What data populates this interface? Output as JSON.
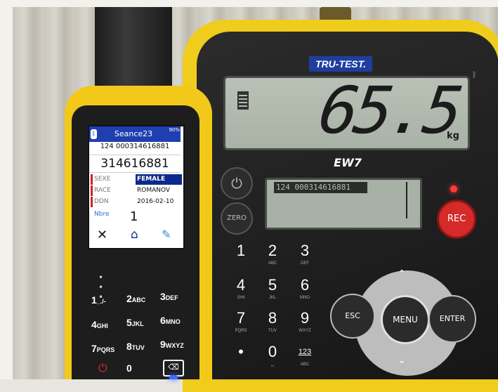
{
  "scale_indicator": {
    "brand": "TRU-TEST.",
    "model": "EW7",
    "weight_value": "65.5",
    "weight_unit": "kg",
    "secondary_display": "124 000314616881",
    "buttons": {
      "power": "⏻",
      "zero": "ZERO",
      "rec": "REC",
      "esc": "ESC",
      "menu": "MENU",
      "enter": "ENTER",
      "up": "⌃",
      "down": "⌄"
    },
    "keypad": [
      {
        "digit": "1",
        "letters": ""
      },
      {
        "digit": "2",
        "letters": "ABC"
      },
      {
        "digit": "3",
        "letters": "DEF"
      },
      {
        "digit": "4",
        "letters": "GHI"
      },
      {
        "digit": "5",
        "letters": "JKL"
      },
      {
        "digit": "6",
        "letters": "MNO"
      },
      {
        "digit": "7",
        "letters": "PQRS"
      },
      {
        "digit": "8",
        "letters": "TUV"
      },
      {
        "digit": "9",
        "letters": "WXYZ"
      },
      {
        "digit": "•",
        "letters": ""
      },
      {
        "digit": "0",
        "letters": "␣"
      },
      {
        "digit": "123",
        "letters": "ABC"
      }
    ]
  },
  "reader": {
    "screen": {
      "session": "Seance23",
      "battery": "90%",
      "eid": "124 000314616881",
      "tag": "314616881",
      "fields": [
        {
          "label": "SEXE",
          "value": "FEMALE"
        },
        {
          "label": "RACE",
          "value": "ROMANOV"
        },
        {
          "label": "DDN",
          "value": "2016-02-10"
        }
      ],
      "count_label": "Nbre",
      "count_value": "1",
      "icons": {
        "close": "✕",
        "home": "⌂",
        "edit": "✎",
        "bluetooth": "ᛒ"
      }
    },
    "keys": [
      {
        "digit": "1",
        "letters": "_./-"
      },
      {
        "digit": "2",
        "letters": "ABC"
      },
      {
        "digit": "3",
        "letters": "DEF"
      },
      {
        "digit": "4",
        "letters": "GHI"
      },
      {
        "digit": "5",
        "letters": "JKL"
      },
      {
        "digit": "6",
        "letters": "MNO"
      },
      {
        "digit": "7",
        "letters": "PQRS"
      },
      {
        "digit": "8",
        "letters": "TUV"
      },
      {
        "digit": "9",
        "letters": "WXYZ"
      },
      {
        "digit": "0",
        "letters": ""
      }
    ],
    "dots": "• • •",
    "power_glyph": "⏻",
    "backspace_glyph": "⌫"
  },
  "colors": {
    "device_yellow": "#f0cc1c",
    "rec_red": "#d42a2a",
    "brand_blue": "#1f3ea0"
  }
}
